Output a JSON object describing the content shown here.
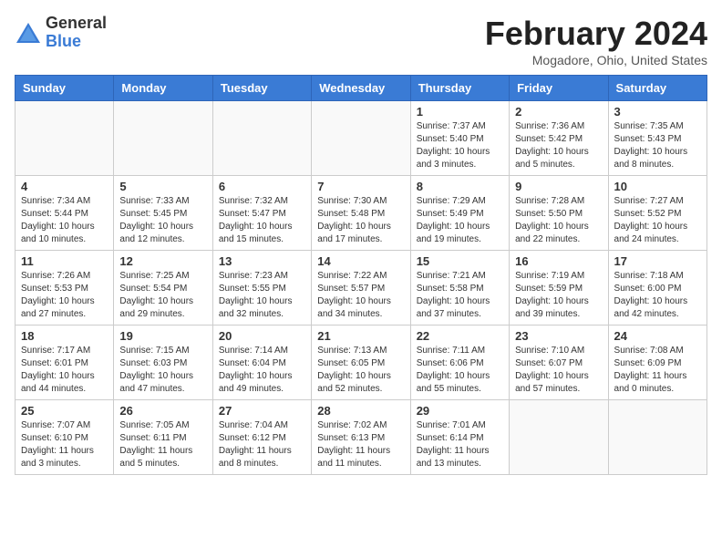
{
  "logo": {
    "general": "General",
    "blue": "Blue"
  },
  "title": "February 2024",
  "location": "Mogadore, Ohio, United States",
  "days_of_week": [
    "Sunday",
    "Monday",
    "Tuesday",
    "Wednesday",
    "Thursday",
    "Friday",
    "Saturday"
  ],
  "weeks": [
    [
      {
        "day": "",
        "info": ""
      },
      {
        "day": "",
        "info": ""
      },
      {
        "day": "",
        "info": ""
      },
      {
        "day": "",
        "info": ""
      },
      {
        "day": "1",
        "info": "Sunrise: 7:37 AM\nSunset: 5:40 PM\nDaylight: 10 hours\nand 3 minutes."
      },
      {
        "day": "2",
        "info": "Sunrise: 7:36 AM\nSunset: 5:42 PM\nDaylight: 10 hours\nand 5 minutes."
      },
      {
        "day": "3",
        "info": "Sunrise: 7:35 AM\nSunset: 5:43 PM\nDaylight: 10 hours\nand 8 minutes."
      }
    ],
    [
      {
        "day": "4",
        "info": "Sunrise: 7:34 AM\nSunset: 5:44 PM\nDaylight: 10 hours\nand 10 minutes."
      },
      {
        "day": "5",
        "info": "Sunrise: 7:33 AM\nSunset: 5:45 PM\nDaylight: 10 hours\nand 12 minutes."
      },
      {
        "day": "6",
        "info": "Sunrise: 7:32 AM\nSunset: 5:47 PM\nDaylight: 10 hours\nand 15 minutes."
      },
      {
        "day": "7",
        "info": "Sunrise: 7:30 AM\nSunset: 5:48 PM\nDaylight: 10 hours\nand 17 minutes."
      },
      {
        "day": "8",
        "info": "Sunrise: 7:29 AM\nSunset: 5:49 PM\nDaylight: 10 hours\nand 19 minutes."
      },
      {
        "day": "9",
        "info": "Sunrise: 7:28 AM\nSunset: 5:50 PM\nDaylight: 10 hours\nand 22 minutes."
      },
      {
        "day": "10",
        "info": "Sunrise: 7:27 AM\nSunset: 5:52 PM\nDaylight: 10 hours\nand 24 minutes."
      }
    ],
    [
      {
        "day": "11",
        "info": "Sunrise: 7:26 AM\nSunset: 5:53 PM\nDaylight: 10 hours\nand 27 minutes."
      },
      {
        "day": "12",
        "info": "Sunrise: 7:25 AM\nSunset: 5:54 PM\nDaylight: 10 hours\nand 29 minutes."
      },
      {
        "day": "13",
        "info": "Sunrise: 7:23 AM\nSunset: 5:55 PM\nDaylight: 10 hours\nand 32 minutes."
      },
      {
        "day": "14",
        "info": "Sunrise: 7:22 AM\nSunset: 5:57 PM\nDaylight: 10 hours\nand 34 minutes."
      },
      {
        "day": "15",
        "info": "Sunrise: 7:21 AM\nSunset: 5:58 PM\nDaylight: 10 hours\nand 37 minutes."
      },
      {
        "day": "16",
        "info": "Sunrise: 7:19 AM\nSunset: 5:59 PM\nDaylight: 10 hours\nand 39 minutes."
      },
      {
        "day": "17",
        "info": "Sunrise: 7:18 AM\nSunset: 6:00 PM\nDaylight: 10 hours\nand 42 minutes."
      }
    ],
    [
      {
        "day": "18",
        "info": "Sunrise: 7:17 AM\nSunset: 6:01 PM\nDaylight: 10 hours\nand 44 minutes."
      },
      {
        "day": "19",
        "info": "Sunrise: 7:15 AM\nSunset: 6:03 PM\nDaylight: 10 hours\nand 47 minutes."
      },
      {
        "day": "20",
        "info": "Sunrise: 7:14 AM\nSunset: 6:04 PM\nDaylight: 10 hours\nand 49 minutes."
      },
      {
        "day": "21",
        "info": "Sunrise: 7:13 AM\nSunset: 6:05 PM\nDaylight: 10 hours\nand 52 minutes."
      },
      {
        "day": "22",
        "info": "Sunrise: 7:11 AM\nSunset: 6:06 PM\nDaylight: 10 hours\nand 55 minutes."
      },
      {
        "day": "23",
        "info": "Sunrise: 7:10 AM\nSunset: 6:07 PM\nDaylight: 10 hours\nand 57 minutes."
      },
      {
        "day": "24",
        "info": "Sunrise: 7:08 AM\nSunset: 6:09 PM\nDaylight: 11 hours\nand 0 minutes."
      }
    ],
    [
      {
        "day": "25",
        "info": "Sunrise: 7:07 AM\nSunset: 6:10 PM\nDaylight: 11 hours\nand 3 minutes."
      },
      {
        "day": "26",
        "info": "Sunrise: 7:05 AM\nSunset: 6:11 PM\nDaylight: 11 hours\nand 5 minutes."
      },
      {
        "day": "27",
        "info": "Sunrise: 7:04 AM\nSunset: 6:12 PM\nDaylight: 11 hours\nand 8 minutes."
      },
      {
        "day": "28",
        "info": "Sunrise: 7:02 AM\nSunset: 6:13 PM\nDaylight: 11 hours\nand 11 minutes."
      },
      {
        "day": "29",
        "info": "Sunrise: 7:01 AM\nSunset: 6:14 PM\nDaylight: 11 hours\nand 13 minutes."
      },
      {
        "day": "",
        "info": ""
      },
      {
        "day": "",
        "info": ""
      }
    ]
  ]
}
